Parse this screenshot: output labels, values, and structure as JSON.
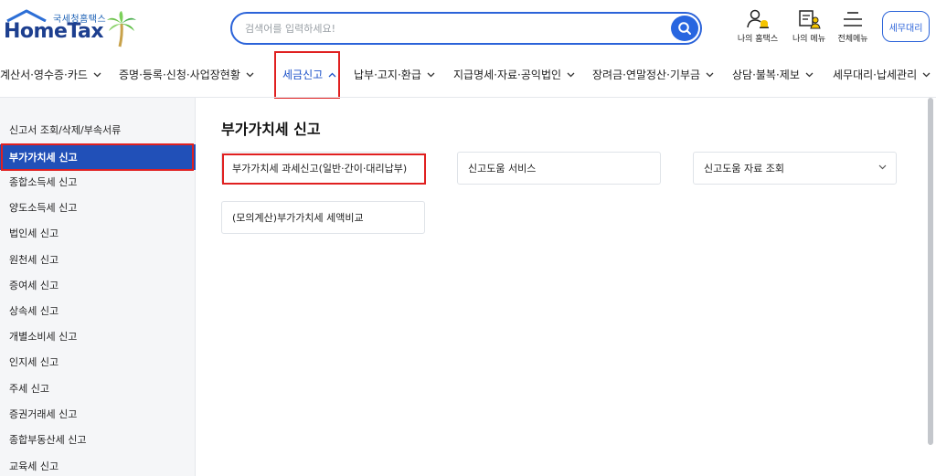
{
  "header": {
    "logo_sub": "국세청홈택스",
    "logo_main": "HomeTax",
    "search_placeholder": "검색어를 입력하세요!",
    "util": [
      {
        "label": "나의 홈택스",
        "icon": "user-bell-icon"
      },
      {
        "label": "나의 메뉴",
        "icon": "my-menu-icon"
      },
      {
        "label": "전체메뉴",
        "icon": "hamburger-icon"
      }
    ],
    "tax_agent_button": "세무대리"
  },
  "gnb": {
    "items": [
      {
        "label": "계산서·영수증·카드"
      },
      {
        "label": "증명·등록·신청·사업장현황"
      },
      {
        "label": "세금신고",
        "active": true
      },
      {
        "label": "납부·고지·환급"
      },
      {
        "label": "지급명세·자료·공익법인"
      },
      {
        "label": "장려금·연말정산·기부금"
      },
      {
        "label": "상담·불복·제보"
      },
      {
        "label": "세무대리·납세관리"
      }
    ]
  },
  "sidebar": {
    "items": [
      {
        "label": "신고서 조회/삭제/부속서류"
      },
      {
        "label": "부가가치세 신고",
        "active": true
      },
      {
        "label": "종합소득세 신고"
      },
      {
        "label": "양도소득세 신고"
      },
      {
        "label": "법인세 신고"
      },
      {
        "label": "원천세 신고"
      },
      {
        "label": "증여세 신고"
      },
      {
        "label": "상속세 신고"
      },
      {
        "label": "개별소비세 신고"
      },
      {
        "label": "인지세 신고"
      },
      {
        "label": "주세 신고"
      },
      {
        "label": "증권거래세 신고"
      },
      {
        "label": "종합부동산세 신고"
      },
      {
        "label": "교육세 신고"
      }
    ]
  },
  "main": {
    "title": "부가가치세 신고",
    "cards": [
      {
        "label": "부가가치세 과세신고(일반·간이·대리납부)"
      },
      {
        "label": "신고도움 서비스"
      },
      {
        "label": "신고도움 자료 조회"
      },
      {
        "label": "(모의계산)부가가치세 세액비교"
      }
    ]
  },
  "colors": {
    "brand": "#1d3f8f",
    "accent": "#2866e0",
    "sidebar_active": "#2150b8",
    "highlight": "#e02020"
  }
}
